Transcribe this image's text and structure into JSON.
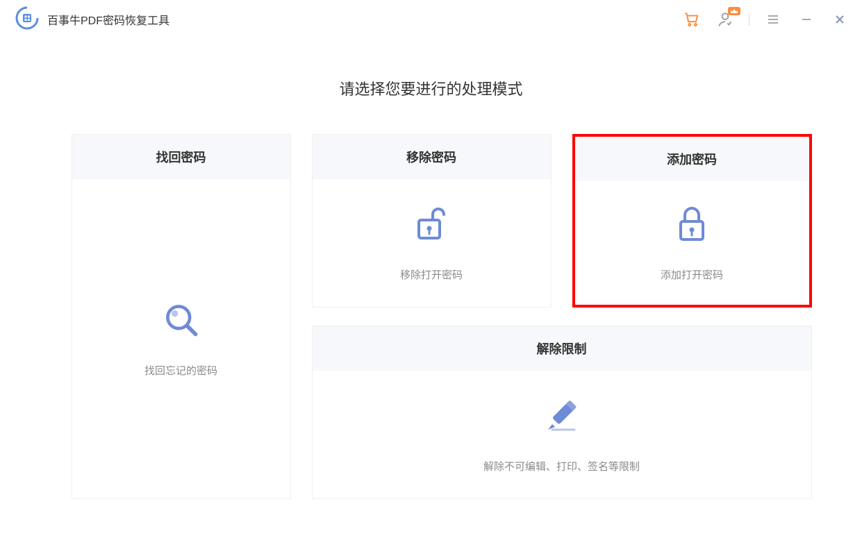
{
  "app": {
    "title": "百事牛PDF密码恢复工具"
  },
  "heading": "请选择您要进行的处理模式",
  "cards": {
    "recover": {
      "title": "找回密码",
      "desc": "找回忘记的密码"
    },
    "remove": {
      "title": "移除密码",
      "desc": "移除打开密码"
    },
    "add": {
      "title": "添加密码",
      "desc": "添加打开密码"
    },
    "restrict": {
      "title": "解除限制",
      "desc": "解除不可编辑、打印、签名等限制"
    }
  },
  "colors": {
    "accent": "#6f8ad6",
    "highlight": "#ff0000",
    "vip": "#ff8a3d"
  }
}
